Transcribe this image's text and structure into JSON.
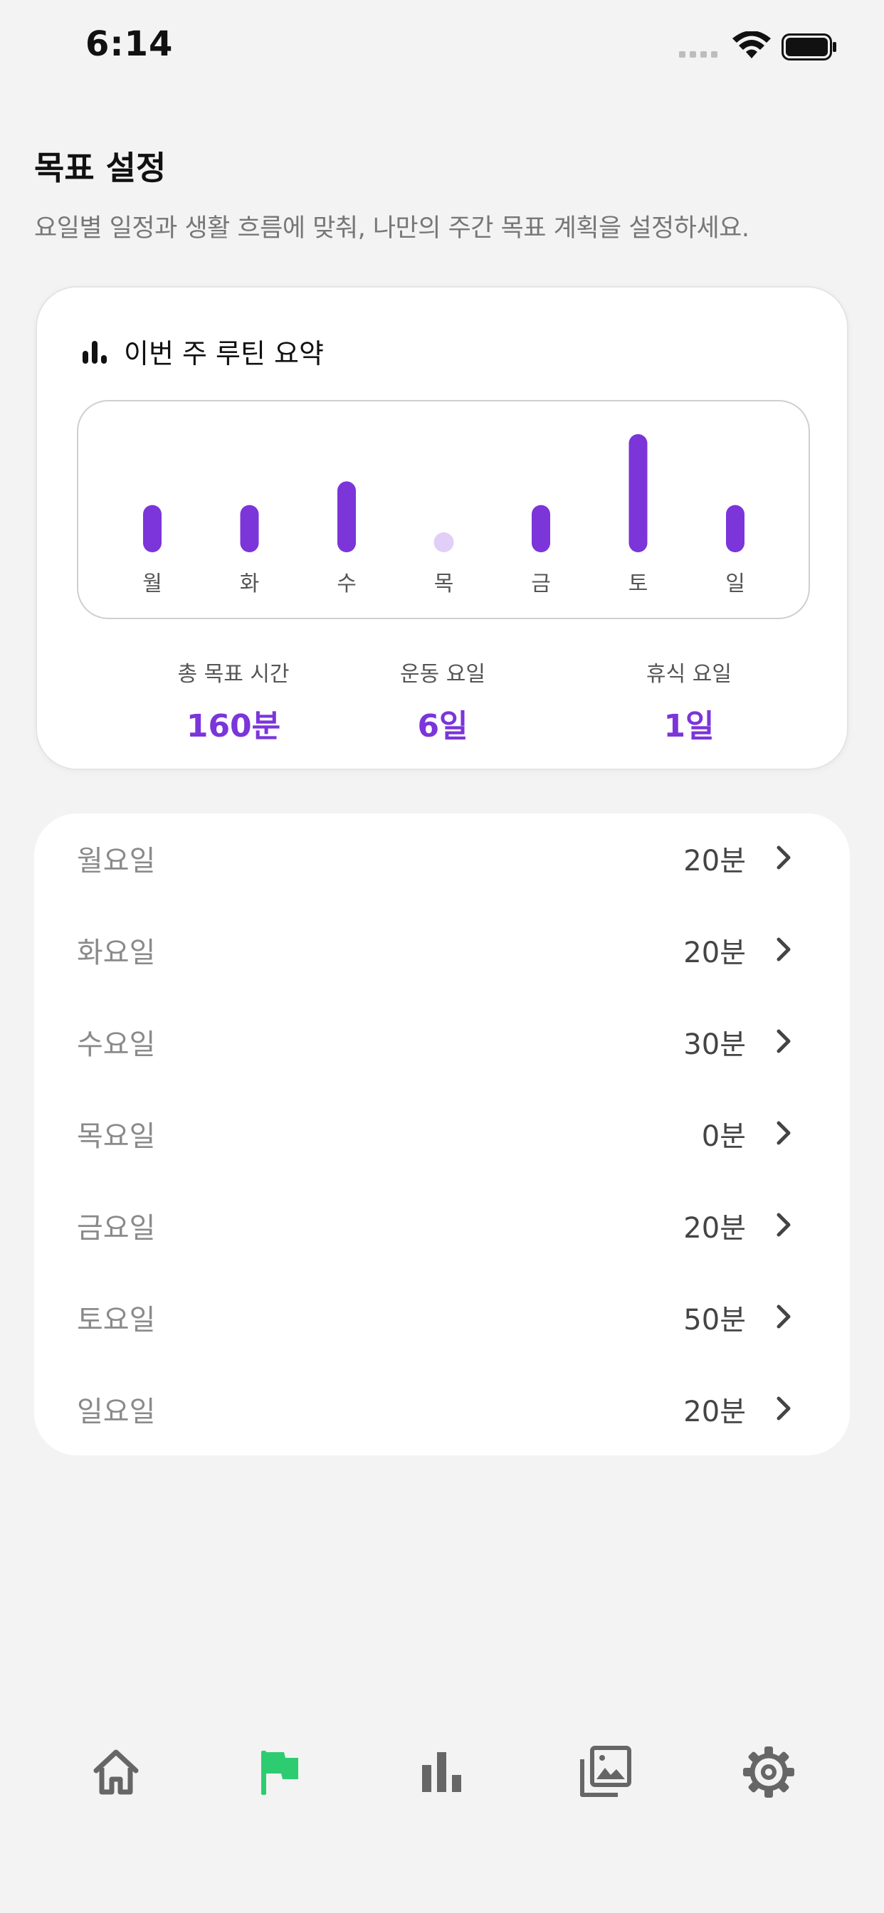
{
  "status_bar": {
    "time": "6:14"
  },
  "header": {
    "title": "목표 설정",
    "subtitle": "요일별 일정과 생활 흐름에 맞춰, 나만의 주간 목표 계획을 설정하세요."
  },
  "summary": {
    "title": "이번 주 루틴 요약",
    "icon": "bar-chart-icon",
    "stats": [
      {
        "label": "총 목표 시간",
        "value": "160분"
      },
      {
        "label": "운동 요일",
        "value": "6일"
      },
      {
        "label": "휴식 요일",
        "value": "1일"
      }
    ]
  },
  "chart_data": {
    "type": "bar",
    "categories": [
      "월",
      "화",
      "수",
      "목",
      "금",
      "토",
      "일"
    ],
    "values": [
      20,
      20,
      30,
      0,
      20,
      50,
      20
    ],
    "colors": {
      "bar": "#7b35d9",
      "zero": "#e2cff7"
    }
  },
  "days": [
    {
      "name": "월요일",
      "value": "20분"
    },
    {
      "name": "화요일",
      "value": "20분"
    },
    {
      "name": "수요일",
      "value": "30분"
    },
    {
      "name": "목요일",
      "value": "0분"
    },
    {
      "name": "금요일",
      "value": "20분"
    },
    {
      "name": "토요일",
      "value": "50분"
    },
    {
      "name": "일요일",
      "value": "20분"
    }
  ],
  "tabs": [
    {
      "icon": "home-icon",
      "active": false
    },
    {
      "icon": "flag-icon",
      "active": true
    },
    {
      "icon": "stats-icon",
      "active": false
    },
    {
      "icon": "gallery-icon",
      "active": false
    },
    {
      "icon": "settings-icon",
      "active": false
    }
  ],
  "colors": {
    "accent": "#7b35d9",
    "active_tab": "#2ecc71",
    "inactive_tab": "#666666"
  }
}
